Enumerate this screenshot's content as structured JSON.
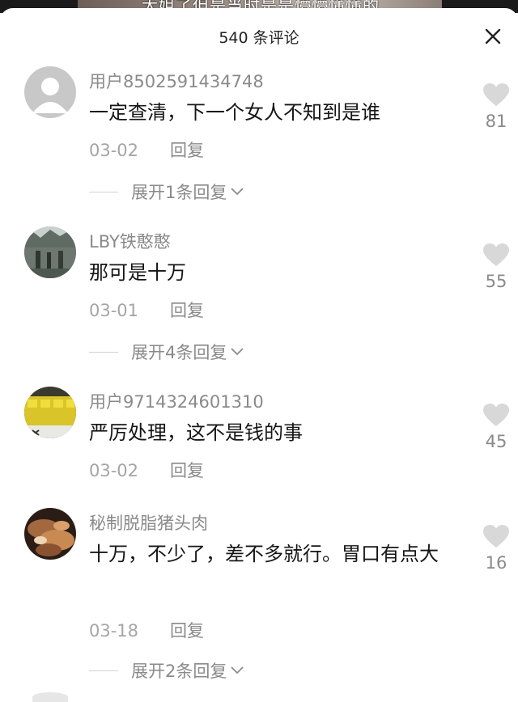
{
  "video": {
    "caption": "大姐了但是当时是是懵懵懂懂的"
  },
  "header": {
    "title": "540 条评论",
    "close_icon": "close-icon"
  },
  "comments": [
    {
      "username": "用户8502591434748",
      "text": "一定查清，下一个女人不知到是谁",
      "date": "03-02",
      "reply_label": "回复",
      "expand_label": "展开1条回复",
      "likes": "81",
      "avatar": "default-user-avatar"
    },
    {
      "username": "LBY铁憨憨",
      "text": "那可是十万",
      "date": "03-01",
      "reply_label": "回复",
      "expand_label": "展开4条回复",
      "likes": "55",
      "avatar": "photo-avatar-outdoor"
    },
    {
      "username": "用户9714324601310",
      "text": "严厉处理，这不是钱的事",
      "date": "03-02",
      "reply_label": "回复",
      "expand_label": "",
      "likes": "45",
      "avatar": "photo-avatar-yellow-panel"
    },
    {
      "username": "秘制脱脂猪头肉",
      "text": "十万，不少了，差不多就行。胃口有点大",
      "date": "03-18",
      "reply_label": "回复",
      "expand_label": "展开2条回复",
      "likes": "16",
      "avatar": "photo-avatar-food"
    }
  ],
  "colors": {
    "text_primary": "#161616",
    "text_secondary": "#8a8a8a",
    "heart": "#d8d8d8"
  }
}
